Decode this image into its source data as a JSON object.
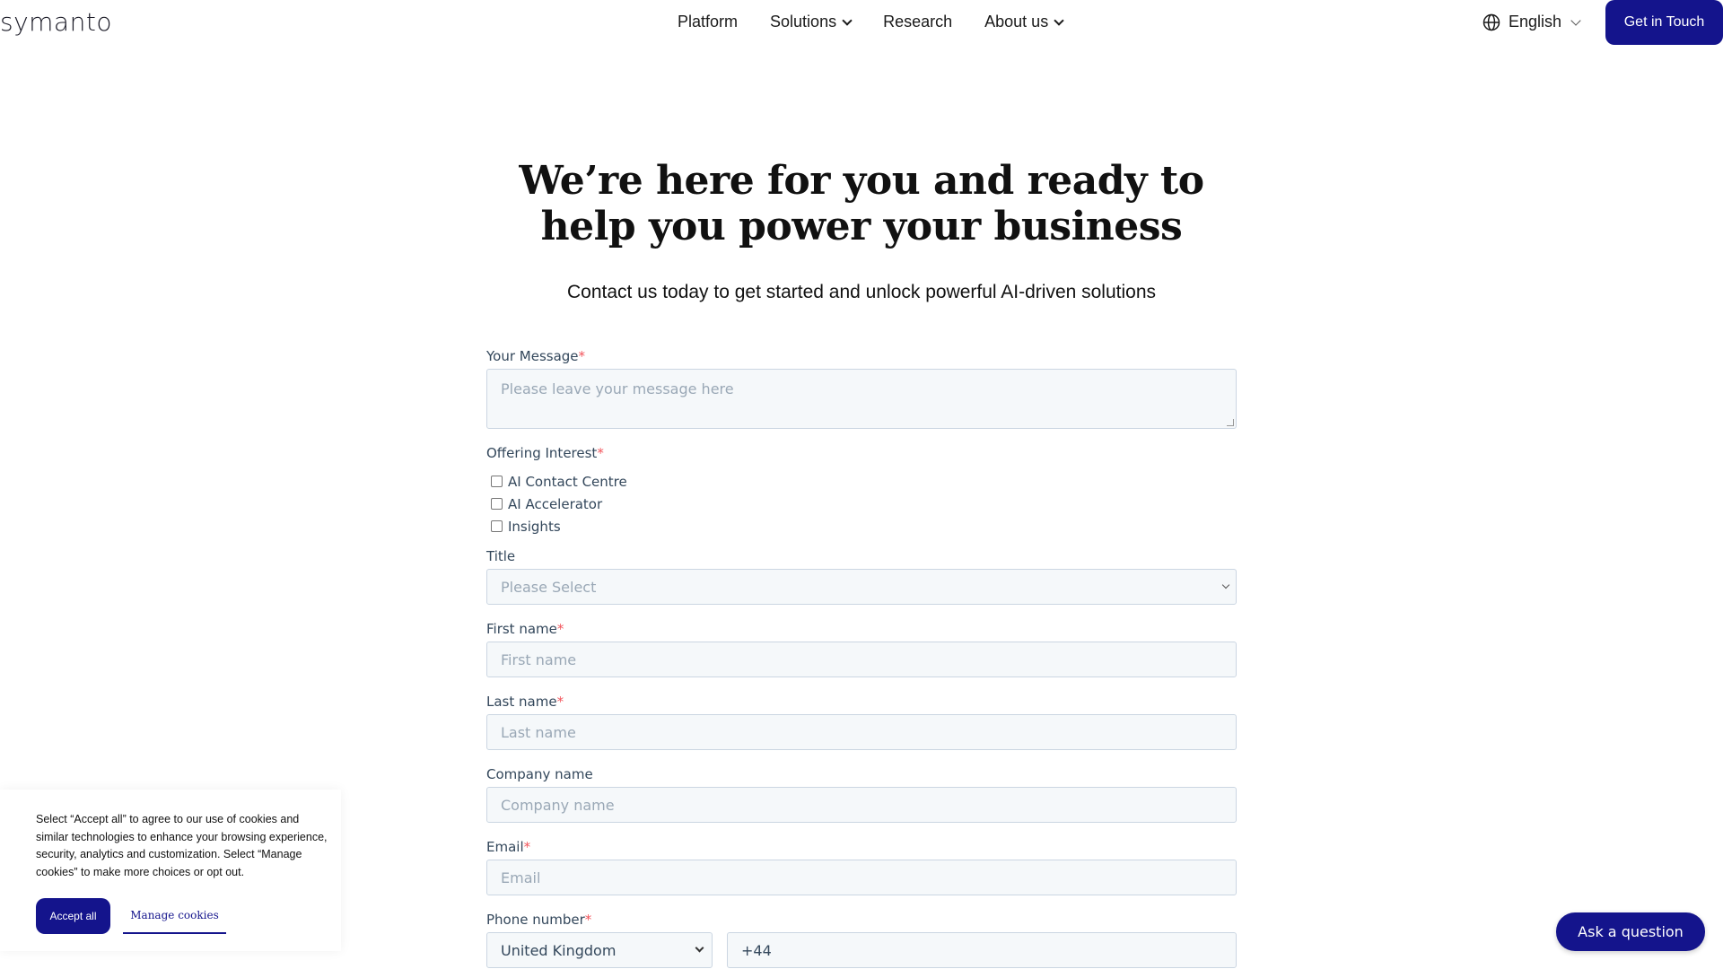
{
  "header": {
    "logo": "symanto",
    "nav": [
      {
        "label": "Platform",
        "has_dropdown": false
      },
      {
        "label": "Solutions",
        "has_dropdown": true
      },
      {
        "label": "Research",
        "has_dropdown": false
      },
      {
        "label": "About us",
        "has_dropdown": true
      }
    ],
    "language": "English",
    "cta_label": "Get in Touch"
  },
  "hero": {
    "title": "We’re here for you and ready to help you power your business",
    "subtitle": "Contact us today to get started and unlock powerful AI-driven solutions"
  },
  "form": {
    "message": {
      "label": "Your Message",
      "required": "*",
      "placeholder": "Please leave your message here"
    },
    "offering": {
      "label": "Offering Interest",
      "required": "*",
      "options": [
        "AI Contact Centre",
        "AI Accelerator",
        "Insights"
      ]
    },
    "title": {
      "label": "Title",
      "placeholder": "Please Select"
    },
    "first_name": {
      "label": "First name",
      "required": "*",
      "placeholder": "First name"
    },
    "last_name": {
      "label": "Last name",
      "required": "*",
      "placeholder": "Last name"
    },
    "company": {
      "label": "Company name",
      "placeholder": "Company name"
    },
    "email": {
      "label": "Email",
      "required": "*",
      "placeholder": "Email"
    },
    "phone": {
      "label": "Phone number",
      "required": "*",
      "country": "United Kingdom",
      "code": "+44"
    }
  },
  "cookie_banner": {
    "text": "Select “Accept all” to agree to our use of cookies and similar technologies to enhance your browsing experience, security, analytics and customization. Select “Manage cookies” to make more choices or opt out.",
    "accept_label": "Accept all",
    "manage_label": "Manage cookies"
  },
  "chat": {
    "label": "Ask a question"
  },
  "colors": {
    "brand": "#14148c",
    "required": "#f2545b",
    "field_bg": "#f5f8fa"
  }
}
